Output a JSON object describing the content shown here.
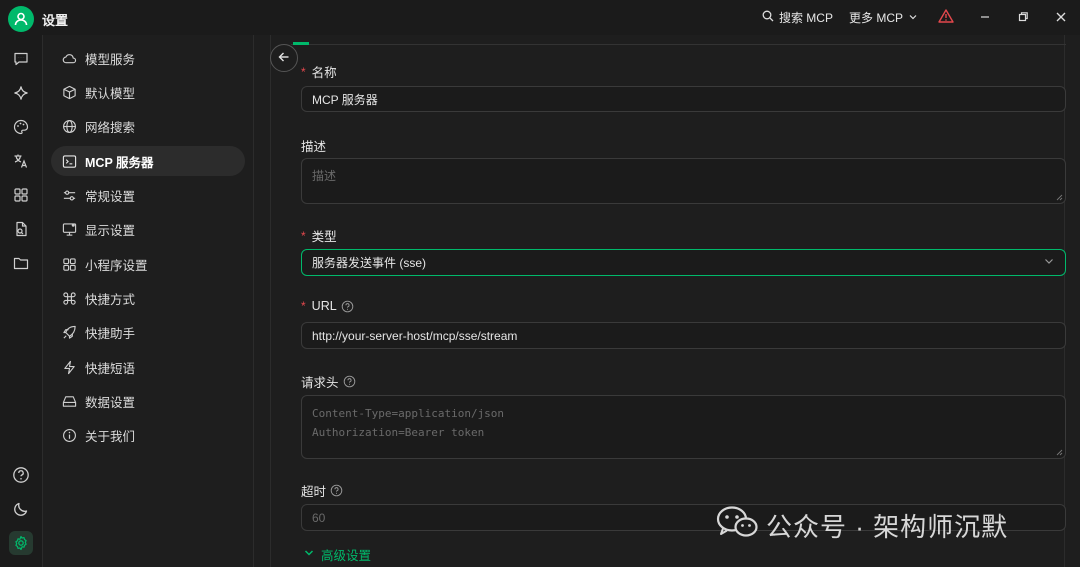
{
  "window": {
    "title": "设置"
  },
  "titlebar": {
    "search_mcp": "搜索 MCP",
    "more_mcp": "更多 MCP"
  },
  "nav": {
    "items": [
      {
        "label": "模型服务",
        "icon": "cloud-icon"
      },
      {
        "label": "默认模型",
        "icon": "cube-icon"
      },
      {
        "label": "网络搜索",
        "icon": "globe-icon"
      },
      {
        "label": "MCP 服务器",
        "icon": "terminal-icon",
        "active": true
      },
      {
        "label": "常规设置",
        "icon": "sliders-icon"
      },
      {
        "label": "显示设置",
        "icon": "monitor-icon"
      },
      {
        "label": "小程序设置",
        "icon": "grid-icon"
      },
      {
        "label": "快捷方式",
        "icon": "command-icon"
      },
      {
        "label": "快捷助手",
        "icon": "rocket-icon"
      },
      {
        "label": "快捷短语",
        "icon": "zap-icon"
      },
      {
        "label": "数据设置",
        "icon": "hard-drive-icon"
      },
      {
        "label": "关于我们",
        "icon": "info-icon"
      }
    ]
  },
  "form": {
    "name_label": "名称",
    "name_value": "MCP 服务器",
    "desc_label": "描述",
    "desc_placeholder": "描述",
    "type_label": "类型",
    "type_value": "服务器发送事件 (sse)",
    "url_label": "URL",
    "url_value": "http://your-server-host/mcp/sse/stream",
    "headers_label": "请求头",
    "headers_placeholder_line1": "Content-Type=application/json",
    "headers_placeholder_line2": "Authorization=Bearer token",
    "timeout_label": "超时",
    "timeout_placeholder": "60",
    "advanced_label": "高级设置"
  },
  "watermark": {
    "text": "公众号 · 架构师沉默"
  },
  "colors": {
    "accent": "#00b96b",
    "required": "#e5484d",
    "warning": "#e5484d"
  }
}
